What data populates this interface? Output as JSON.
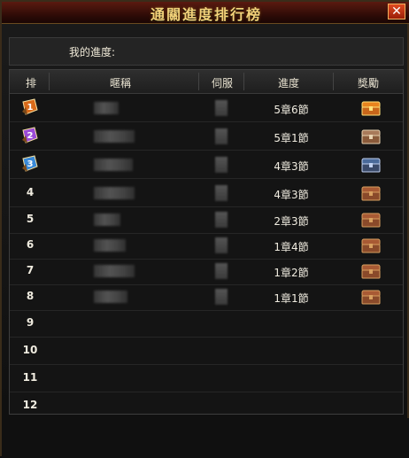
{
  "window": {
    "title": "通關進度排行榜",
    "close_label": "✕"
  },
  "my_progress": {
    "label": "我的進度:"
  },
  "table": {
    "headers": [
      "排",
      "暱稱",
      "伺服",
      "進度",
      "獎勵"
    ],
    "rows": [
      {
        "rank": "1",
        "progress": "5章6節",
        "reward": "gold-chest-icon"
      },
      {
        "rank": "2",
        "progress": "5章1節",
        "reward": "silver-chest-icon"
      },
      {
        "rank": "3",
        "progress": "4章3節",
        "reward": "blue-chest-icon"
      },
      {
        "rank": "4",
        "progress": "4章3節",
        "reward": "bronze-chest-icon"
      },
      {
        "rank": "5",
        "progress": "2章3節",
        "reward": "bronze-chest-icon"
      },
      {
        "rank": "6",
        "progress": "1章4節",
        "reward": "bronze-chest-icon"
      },
      {
        "rank": "7",
        "progress": "1章2節",
        "reward": "bronze-chest-icon"
      },
      {
        "rank": "8",
        "progress": "1章1節",
        "reward": "bronze-chest-icon"
      },
      {
        "rank": "9",
        "progress": "",
        "reward": ""
      },
      {
        "rank": "10",
        "progress": "",
        "reward": ""
      },
      {
        "rank": "11",
        "progress": "",
        "reward": ""
      },
      {
        "rank": "12",
        "progress": "",
        "reward": ""
      }
    ]
  },
  "colors": {
    "title": "#f2d27a",
    "rank1": "#d86a1a",
    "rank2": "#9a4ad8",
    "rank3": "#3a8ad8"
  }
}
